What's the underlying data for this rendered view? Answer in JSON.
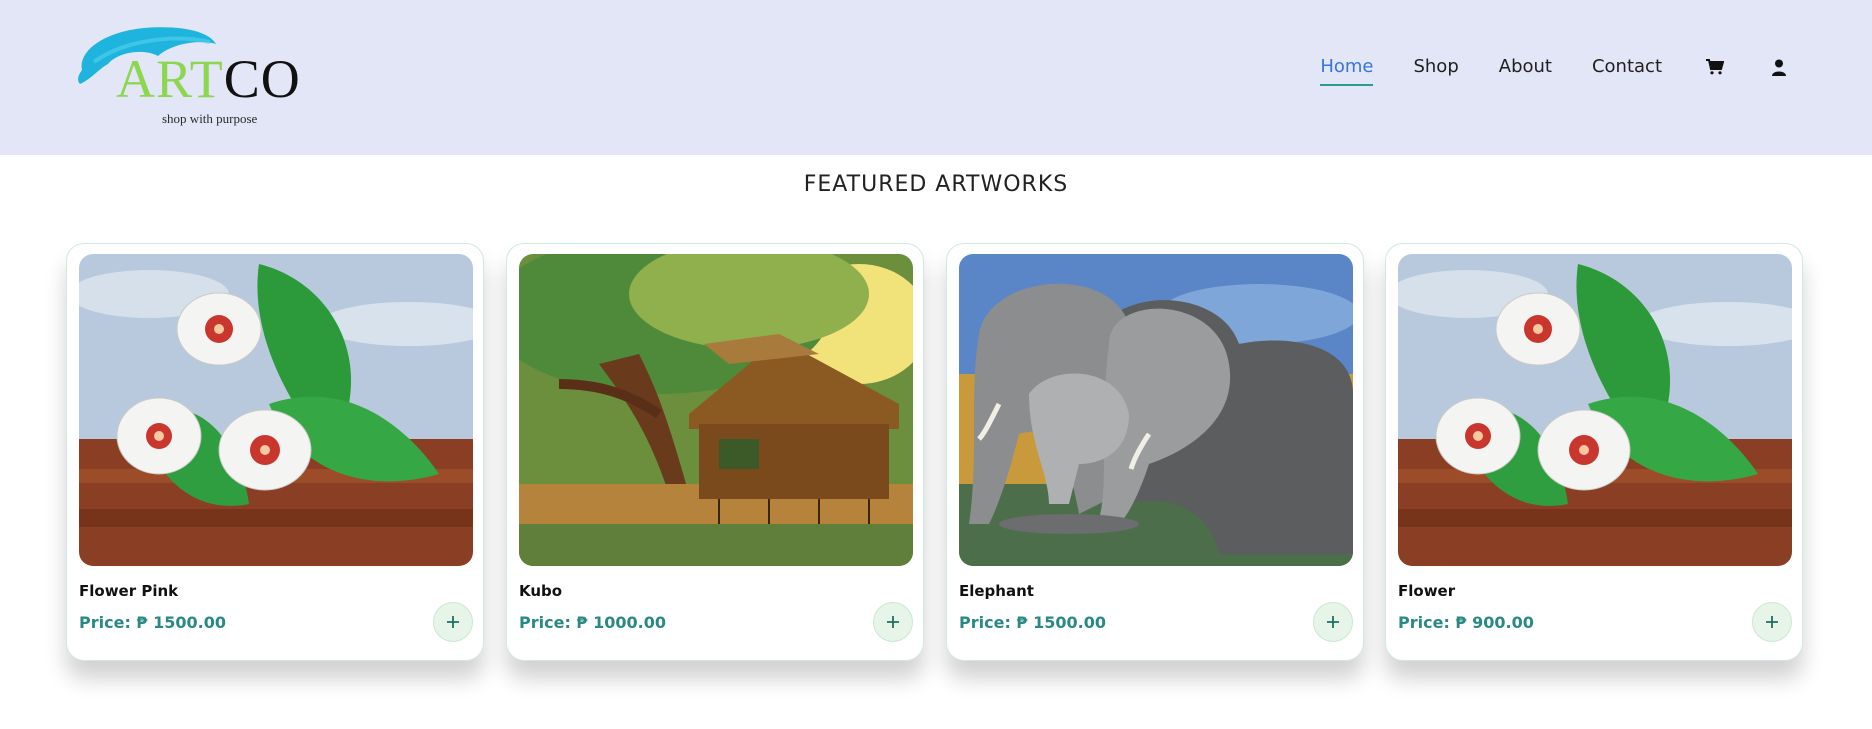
{
  "brand": {
    "logo_word_art": "ART",
    "logo_word_co": "CO",
    "tagline": "shop with purpose",
    "colors": {
      "art_green": "#8cd650",
      "brush_blue": "#1eb4dd"
    }
  },
  "nav": {
    "items": [
      {
        "label": "Home",
        "active": true
      },
      {
        "label": "Shop",
        "active": false
      },
      {
        "label": "About",
        "active": false
      },
      {
        "label": "Contact",
        "active": false
      }
    ],
    "icons": [
      "cart-icon",
      "user-icon"
    ],
    "colors": {
      "active": "#3a74d6",
      "underline": "#2a9d8f"
    }
  },
  "section": {
    "title": "FEATURED ARTWORKS"
  },
  "products": [
    {
      "title": "Flower Pink",
      "price": "Price: ₱ 1500.00",
      "image": "flower-painting"
    },
    {
      "title": "Kubo",
      "price": "Price: ₱ 1000.00",
      "image": "kubo-painting"
    },
    {
      "title": "Elephant",
      "price": "Price: ₱ 1500.00",
      "image": "elephant-painting"
    },
    {
      "title": "Flower",
      "price": "Price: ₱ 900.00",
      "image": "flower-painting"
    }
  ],
  "colors": {
    "header_bg": "#e2e6f6",
    "price_text": "#2a8a83",
    "add_button_bg": "#e6f5e8"
  }
}
